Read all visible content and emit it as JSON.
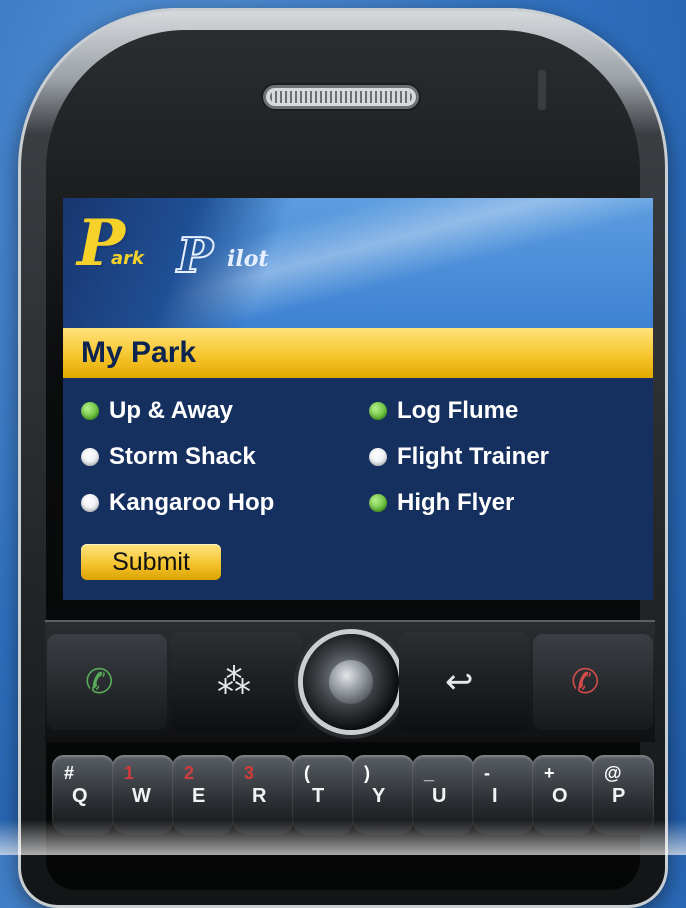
{
  "app": {
    "logo_text": "ParkPilot",
    "title": "My Park"
  },
  "rides": [
    {
      "label": "Up & Away",
      "status": "on"
    },
    {
      "label": "Log Flume",
      "status": "on"
    },
    {
      "label": "Storm Shack",
      "status": "off"
    },
    {
      "label": "Flight Trainer",
      "status": "off"
    },
    {
      "label": "Kangaroo Hop",
      "status": "off"
    },
    {
      "label": "High Flyer",
      "status": "on"
    }
  ],
  "buttons": {
    "submit_label": "Submit"
  },
  "device": {
    "keys_row1": [
      {
        "main": "Q",
        "alt": "#",
        "alt_color": "white"
      },
      {
        "main": "W",
        "alt": "1",
        "alt_color": "red"
      },
      {
        "main": "E",
        "alt": "2",
        "alt_color": "red"
      },
      {
        "main": "R",
        "alt": "3",
        "alt_color": "red"
      },
      {
        "main": "T",
        "alt": "(",
        "alt_color": "white"
      },
      {
        "main": "Y",
        "alt": ")",
        "alt_color": "white"
      },
      {
        "main": "U",
        "alt": "_",
        "alt_color": "white"
      },
      {
        "main": "I",
        "alt": "-",
        "alt_color": "white"
      },
      {
        "main": "O",
        "alt": "+",
        "alt_color": "white"
      },
      {
        "main": "P",
        "alt": "@",
        "alt_color": "white"
      }
    ]
  },
  "colors": {
    "accent_yellow": "#f6c62e",
    "screen_navy": "#15305f",
    "status_on": "#5fb832",
    "status_off": "#ffffff"
  }
}
